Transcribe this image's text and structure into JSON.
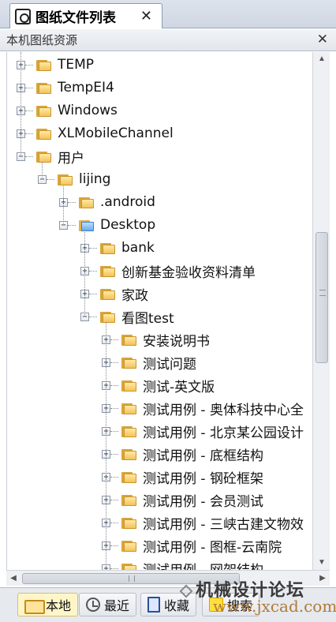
{
  "tab": {
    "title": "图纸文件列表",
    "close": "✕"
  },
  "panel": {
    "title": "本机图纸资源",
    "close": "✕"
  },
  "tree": {
    "expand_glyph": "+",
    "collapse_glyph": "−",
    "rows": [
      {
        "label": "TEMP",
        "level": 0,
        "expanded": false
      },
      {
        "label": "TempEI4",
        "level": 0,
        "expanded": false
      },
      {
        "label": "Windows",
        "level": 0,
        "expanded": false
      },
      {
        "label": "XLMobileChannel",
        "level": 0,
        "expanded": false
      },
      {
        "label": "用户",
        "level": 0,
        "expanded": true
      },
      {
        "label": "lijing",
        "level": 1,
        "expanded": true
      },
      {
        "label": ".android",
        "level": 2,
        "expanded": false
      },
      {
        "label": "Desktop",
        "level": 2,
        "expanded": true,
        "icon": "desktop"
      },
      {
        "label": "bank",
        "level": 3,
        "expanded": false
      },
      {
        "label": "创新基金验收资料清单",
        "level": 3,
        "expanded": false
      },
      {
        "label": "家政",
        "level": 3,
        "expanded": false
      },
      {
        "label": "看图test",
        "level": 3,
        "expanded": true
      },
      {
        "label": "安装说明书",
        "level": 4,
        "expanded": false
      },
      {
        "label": "测试问题",
        "level": 4,
        "expanded": false
      },
      {
        "label": "测试-英文版",
        "level": 4,
        "expanded": false
      },
      {
        "label": "测试用例 - 奥体科技中心全",
        "level": 4,
        "expanded": false
      },
      {
        "label": "测试用例 - 北京某公园设计",
        "level": 4,
        "expanded": false
      },
      {
        "label": "测试用例 - 底框结构",
        "level": 4,
        "expanded": false
      },
      {
        "label": "测试用例 - 钢砼框架",
        "level": 4,
        "expanded": false
      },
      {
        "label": "测试用例 - 会员测试",
        "level": 4,
        "expanded": false
      },
      {
        "label": "测试用例 - 三峡古建文物效",
        "level": 4,
        "expanded": false
      },
      {
        "label": "测试用例 - 图框-云南院",
        "level": 4,
        "expanded": false
      },
      {
        "label": "测试用例 - 网架结构",
        "level": 4,
        "expanded": false
      }
    ]
  },
  "scroll": {
    "up": "▲",
    "down": "▼",
    "left": "◀",
    "right": "▶",
    "grip_v": "≡",
    "grip_h": "|||"
  },
  "bottom_tabs": [
    {
      "label": "本地",
      "icon": "folder-icon",
      "active": true
    },
    {
      "label": "最近",
      "icon": "clock-icon",
      "active": false
    },
    {
      "label": "收藏",
      "icon": "book-icon",
      "active": false
    },
    {
      "label": "搜索",
      "icon": "search-icon",
      "active": false
    }
  ],
  "watermark": {
    "line1": "机械设计论坛",
    "line2": "www.jxcad.com"
  }
}
